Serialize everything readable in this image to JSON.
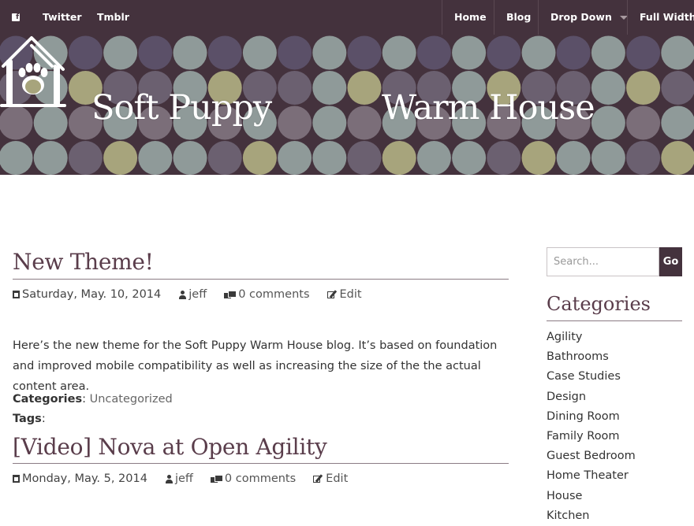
{
  "social": {
    "facebook_icon": "f",
    "twitter_label": "Twitter",
    "tumblr_label": "Tmblr"
  },
  "nav": {
    "items": [
      "Home",
      "Blog",
      "Drop Down",
      "Full Width"
    ]
  },
  "banner": {
    "title_left": "Soft Puppy",
    "title_right": "Warm House",
    "colors": {
      "background": "#44323d",
      "dots": [
        "#5b5068",
        "#a7a47c",
        "#617386",
        "#8f9a99",
        "#7b6e79",
        "#6b6070"
      ]
    }
  },
  "posts": [
    {
      "title": "New Theme!",
      "date": "Saturday, May. 10, 2014",
      "author": "jeff",
      "comments": "0 comments",
      "edit": "Edit",
      "body": "Here’s the new theme for the Soft Puppy Warm House blog. It’s based on foundation and improved mobile compatibility as well as increasing the size of the the actual content area.",
      "categories_label": "Categories",
      "categories_value": "Uncategorized",
      "tags_label": "Tags"
    },
    {
      "title": "[Video] Nova at Open Agility",
      "date": "Monday, May. 5, 2014",
      "author": "jeff",
      "comments": "0 comments",
      "edit": "Edit"
    }
  ],
  "sidebar": {
    "search_placeholder": "Search...",
    "search_button": "Go",
    "categories_title": "Categories",
    "categories": [
      "Agility",
      "Bathrooms",
      "Case Studies",
      "Design",
      "Dining Room",
      "Family Room",
      "Guest Bedroom",
      "Home Theater",
      "House",
      "Kitchen"
    ]
  }
}
